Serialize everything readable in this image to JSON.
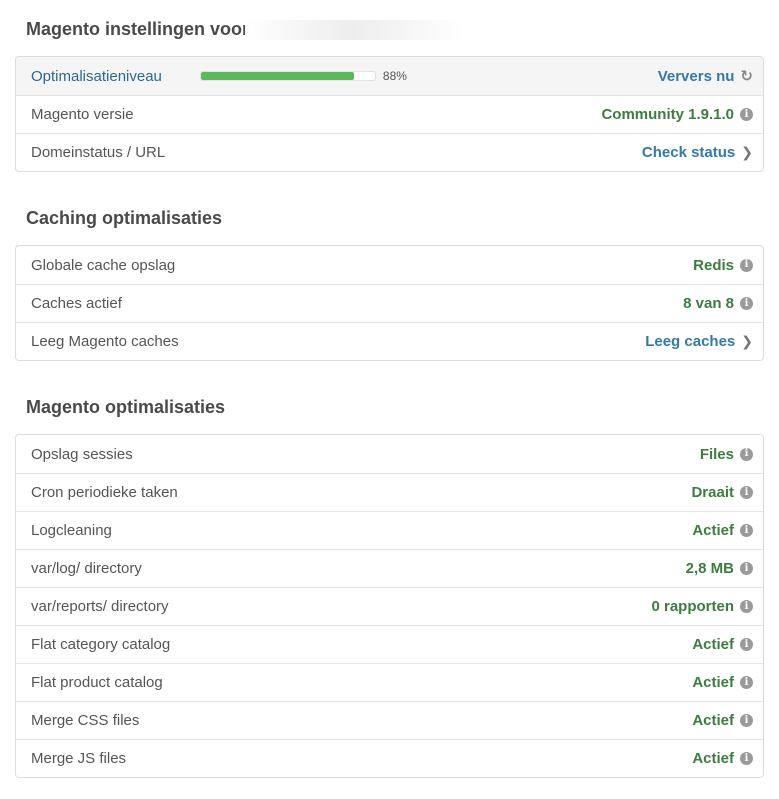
{
  "settings": {
    "title": "Magento instellingen voor",
    "rows": {
      "optimization": {
        "label": "Optimalisatieniveau",
        "progress_percent": 88,
        "progress_text": "88%",
        "action_label": "Ververs nu"
      },
      "version": {
        "label": "Magento versie",
        "value": "Community 1.9.1.0"
      },
      "domain": {
        "label": "Domeinstatus / URL",
        "action_label": "Check status"
      }
    }
  },
  "caching": {
    "title": "Caching optimalisaties",
    "rows": {
      "global_cache": {
        "label": "Globale cache opslag",
        "value": "Redis"
      },
      "active_caches": {
        "label": "Caches actief",
        "value": "8 van 8"
      },
      "flush": {
        "label": "Leeg Magento caches",
        "action_label": "Leeg caches"
      }
    }
  },
  "magento_opt": {
    "title": "Magento optimalisaties",
    "rows": [
      {
        "label": "Opslag sessies",
        "value": "Files"
      },
      {
        "label": "Cron periodieke taken",
        "value": "Draait"
      },
      {
        "label": "Logcleaning",
        "value": "Actief"
      },
      {
        "label": "var/log/ directory",
        "value": "2,8 MB"
      },
      {
        "label": "var/reports/ directory",
        "value": "0 rapporten"
      },
      {
        "label": "Flat category catalog",
        "value": "Actief"
      },
      {
        "label": "Flat product catalog",
        "value": "Actief"
      },
      {
        "label": "Merge CSS files",
        "value": "Actief"
      },
      {
        "label": "Merge JS files",
        "value": "Actief"
      }
    ]
  },
  "icons": {
    "info": "info-icon",
    "refresh": "refresh-icon",
    "chevron": "chevron-right-icon"
  },
  "colors": {
    "progress": "#5cb85c",
    "value_green": "#3d7d3f",
    "link_blue": "#3579a6"
  }
}
